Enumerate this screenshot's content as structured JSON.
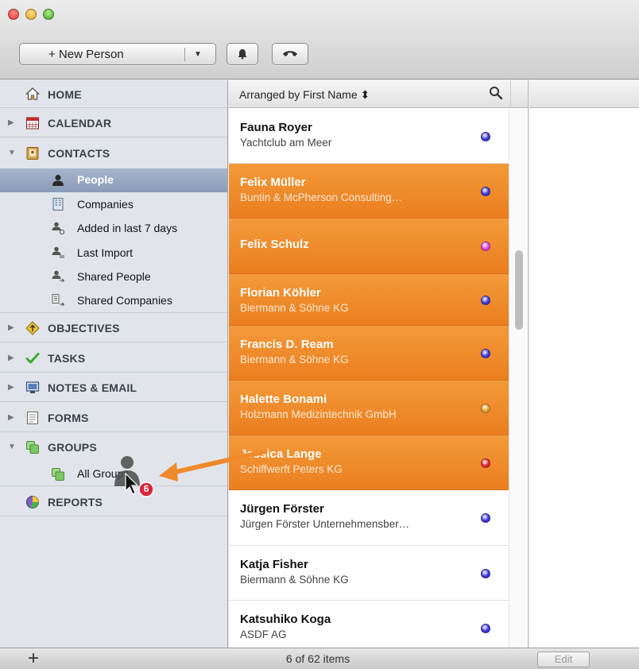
{
  "toolbar": {
    "new_person_label": "+ New Person",
    "new_person_menu": "▼"
  },
  "sidebar": {
    "home": "HOME",
    "calendar": "CALENDAR",
    "contacts": "CONTACTS",
    "contacts_items": [
      {
        "label": "People",
        "icon": "person-icon"
      },
      {
        "label": "Companies",
        "icon": "company-icon"
      },
      {
        "label": "Added in last 7 days",
        "icon": "person-recent-icon"
      },
      {
        "label": "Last Import",
        "icon": "person-import-icon"
      },
      {
        "label": "Shared People",
        "icon": "person-shared-icon"
      },
      {
        "label": "Shared Companies",
        "icon": "company-shared-icon"
      }
    ],
    "objectives": "OBJECTIVES",
    "tasks": "TASKS",
    "notes_email": "NOTES & EMAIL",
    "forms": "FORMS",
    "groups": "GROUPS",
    "groups_items": [
      {
        "label": "All Groups",
        "icon": "groups-icon"
      }
    ],
    "reports": "REPORTS"
  },
  "list": {
    "sort_label": "Arranged by First Name ⬍",
    "rows": [
      {
        "name": "Fauna Royer",
        "sub": "Yachtclub am Meer",
        "dot": "#3a34d6",
        "selected": false
      },
      {
        "name": "Felix Müller",
        "sub": "Buntin & McPherson Consulting…",
        "dot": "#3a34d6",
        "selected": true
      },
      {
        "name": "Felix Schulz",
        "sub": "",
        "dot": "#e23ad6",
        "selected": true
      },
      {
        "name": "Florian Köhler",
        "sub": "Biermann & Söhne KG",
        "dot": "#3a34d6",
        "selected": true
      },
      {
        "name": "Francis D. Ream",
        "sub": "Biermann & Söhne KG",
        "dot": "#3a34d6",
        "selected": true
      },
      {
        "name": "Halette Bonami",
        "sub": "Holzmann Medizintechnik GmbH",
        "dot": "#e69a2a",
        "selected": true
      },
      {
        "name": "Jessica Lange",
        "sub": "Schiffwerft Peters KG",
        "dot": "#e0222a",
        "selected": true
      },
      {
        "name": "Jürgen Förster",
        "sub": "Jürgen Förster Unternehmensber…",
        "dot": "#3a34d6",
        "selected": false
      },
      {
        "name": "Katja Fisher",
        "sub": "Biermann & Söhne KG",
        "dot": "#3a34d6",
        "selected": false
      },
      {
        "name": "Katsuhiko Koga",
        "sub": "ASDF AG",
        "dot": "#3a34d6",
        "selected": false
      }
    ]
  },
  "drag": {
    "count": "6"
  },
  "bottombar": {
    "add": "+",
    "status": "6 of 62 items",
    "edit": "Edit"
  },
  "colors": {
    "selection_orange": "#ef8a2a",
    "sidebar_selection": "#97a8c2"
  }
}
